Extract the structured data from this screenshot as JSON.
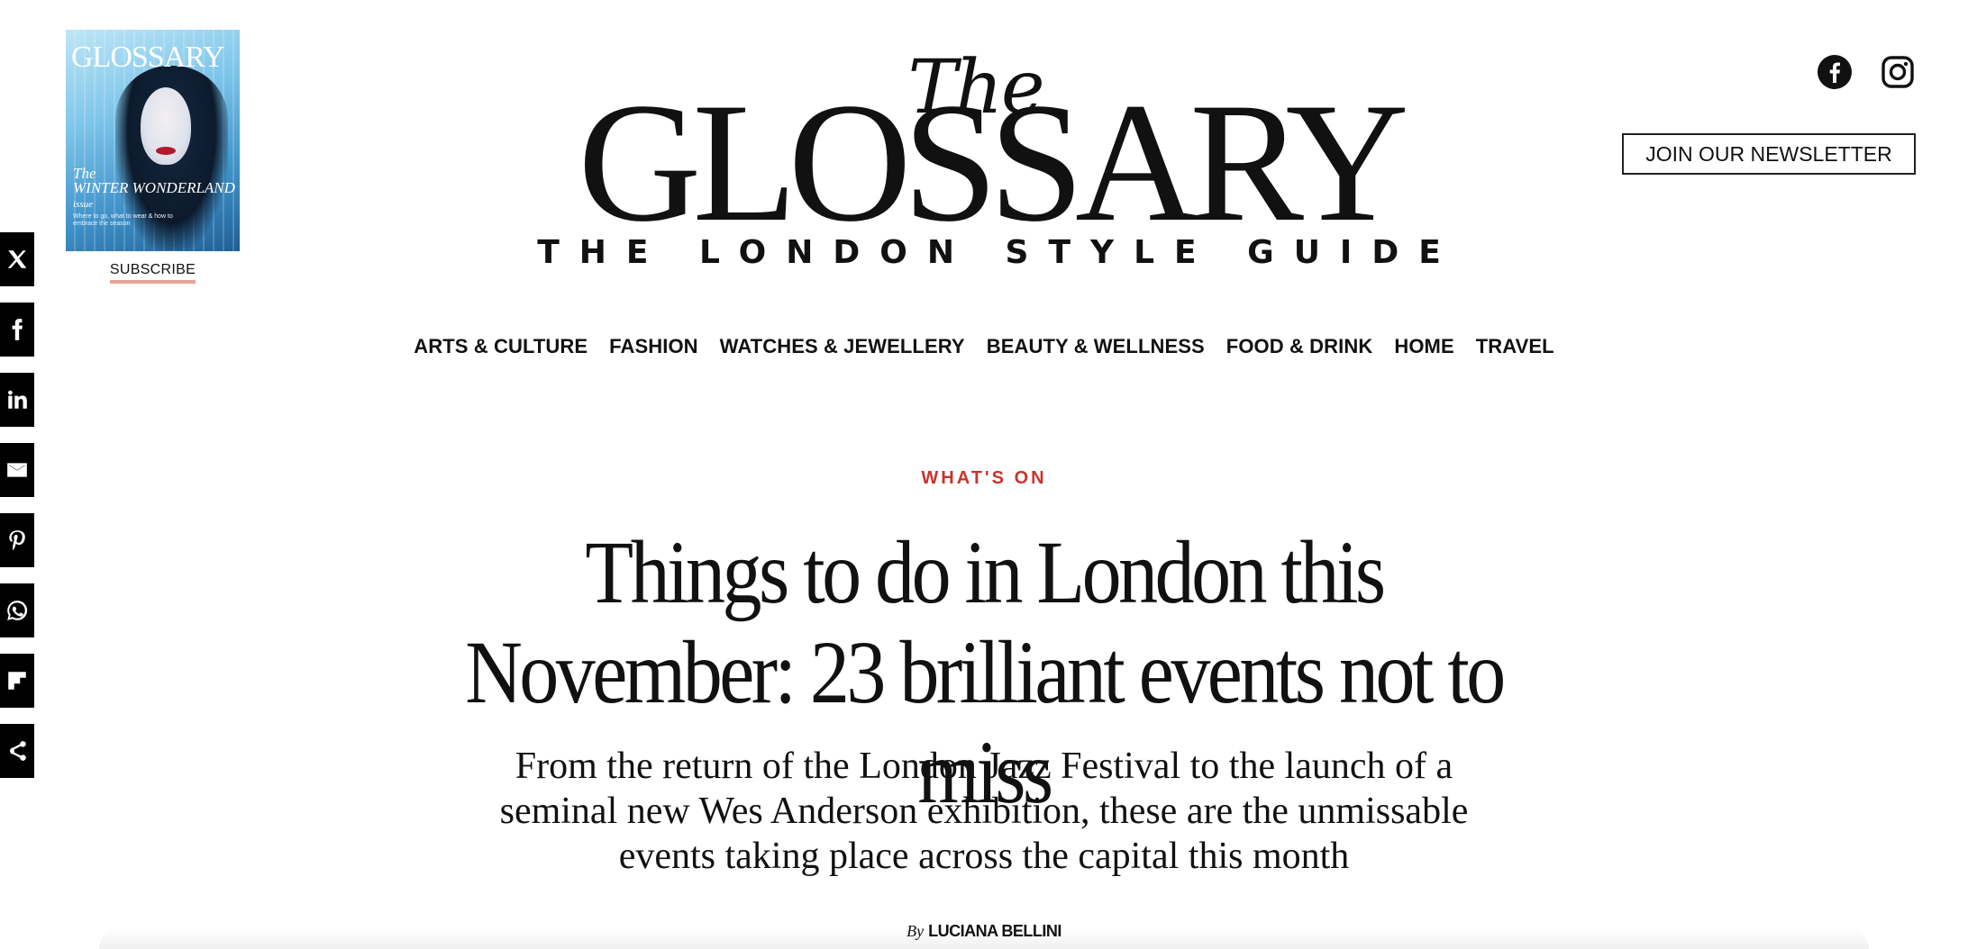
{
  "cover": {
    "masthead": "GLOSSARY",
    "coverline_script": "The",
    "coverline_title": "WINTER WONDERLAND",
    "coverline_issue": "issue",
    "coverline_small": "Where to go, what to wear & how to embrace the season",
    "subscribe_label": "SUBSCRIBE"
  },
  "share": {
    "items": [
      "x-icon",
      "facebook-icon",
      "linkedin-icon",
      "email-icon",
      "pinterest-icon",
      "whatsapp-icon",
      "flipboard-icon",
      "share-icon"
    ]
  },
  "logo": {
    "the": "The",
    "name": "GLOSSARY",
    "tagline": "THE LONDON STYLE GUIDE"
  },
  "social": {
    "icons": [
      "facebook-icon",
      "instagram-icon"
    ]
  },
  "newsletter": {
    "label": "JOIN OUR NEWSLETTER"
  },
  "nav": {
    "items": [
      "ARTS & CULTURE",
      "FASHION",
      "WATCHES & JEWELLERY",
      "BEAUTY & WELLNESS",
      "FOOD & DRINK",
      "HOME",
      "TRAVEL"
    ]
  },
  "article": {
    "category": "WHAT'S ON",
    "headline": "Things to do in London this November: 23 brilliant events not to miss",
    "standfirst": "From the return of the London Jazz Festival to the launch of a seminal new Wes Anderson exhibition, these are the unmissable events taking place across the capital this month",
    "byline_prefix": "By",
    "author": "LUCIANA BELLINI"
  },
  "colors": {
    "accent_red": "#c8342d",
    "subscribe_underline": "#e7a39a",
    "text": "#111111",
    "background": "#ffffff"
  }
}
